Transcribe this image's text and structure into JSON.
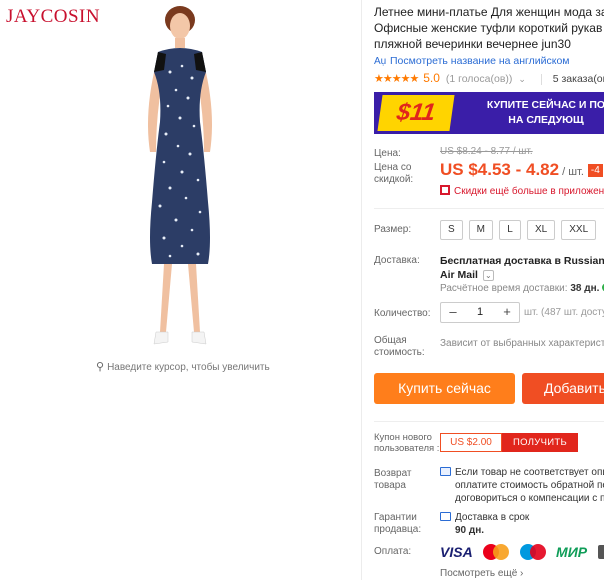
{
  "brand": "JAYCOSIN",
  "zoom_hint": "Наведите курсор, чтобы увеличить",
  "product": {
    "title_lines": [
      "Летнее мини-платье Для женщин мода за",
      "Офисные женские туфли короткий рукав",
      "пляжной вечеринки вечернее jun30"
    ],
    "translate_link": "Посмотреть название на английском",
    "rating_stars": "★★★★★",
    "rating_score": "5.0",
    "rating_votes": "(1 голоса(ов))",
    "orders": "5 заказа(ов)"
  },
  "banner": {
    "price": "$11",
    "text_line1": "КУПИТЕ СЕЙЧАС И ПО",
    "text_line2": "НА СЛЕДУЮЩ"
  },
  "price": {
    "label": "Цена:",
    "old": "US $8.24 - 8.77 / шт.",
    "discount_label": "Цена со скидкой:",
    "new": "US $4.53 - 4.82",
    "per_unit": "/ шт.",
    "badge": "-4",
    "app_discount": "Скидки ещё больше в приложени"
  },
  "size": {
    "label": "Размер:",
    "options": [
      "S",
      "M",
      "L",
      "XL",
      "XXL"
    ]
  },
  "shipping": {
    "label": "Доставка:",
    "line1": "Бесплатная доставка в Russian Fed",
    "line2": "Air Mail",
    "time_label": "Расчётное время доставки:",
    "time_value": "38 дн."
  },
  "quantity": {
    "label": "Количество:",
    "value": "1",
    "note": "шт. (487 шт. досту"
  },
  "total": {
    "label": "Общая стоимость:",
    "note": "Зависит от выбранных характерист"
  },
  "actions": {
    "buy": "Купить сейчас",
    "cart": "Добавить"
  },
  "coupon": {
    "label": "Купон нового пользователя :",
    "value": "US $2.00",
    "button": "ПОЛУЧИТЬ"
  },
  "returns": {
    "label": "Возврат товара",
    "line1": "Если товар не соответствует опис",
    "line2": "оплатите стоимость обратной пер",
    "line3": "договориться о компенсации с п"
  },
  "guarantee": {
    "label": "Гарантии продавца:",
    "line1": "Доставка в срок",
    "line2": "90 дн."
  },
  "payment": {
    "label": "Оплата:",
    "visa": "VISA",
    "mir": "МИР",
    "see_all": "Посмотреть ещё ›"
  },
  "colors": {
    "accent_orange": "#ff7e1b",
    "accent_red": "#f04e23",
    "banner_bg": "#3a1ea8",
    "link_blue": "#2b6cd4"
  }
}
